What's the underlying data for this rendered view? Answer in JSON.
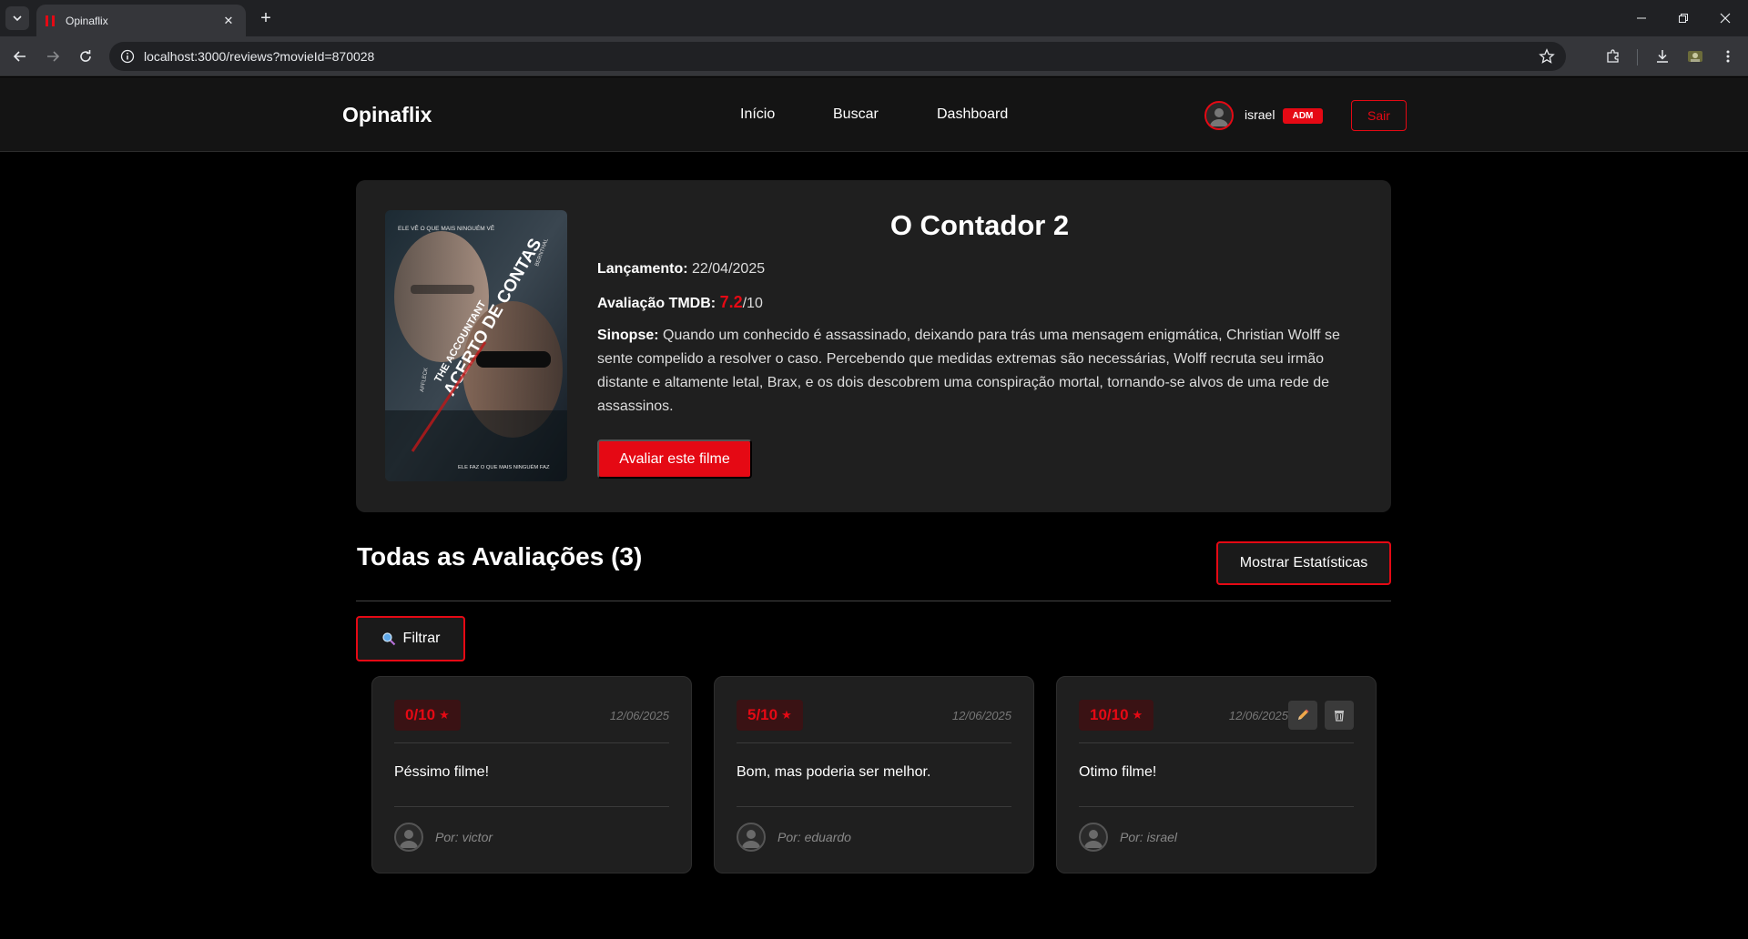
{
  "browser": {
    "tab_title": "Opinaflix",
    "url": "localhost:3000/reviews?movieId=870028"
  },
  "colors": {
    "accent": "#e50914",
    "background": "#000000",
    "card": "#1f1f1f",
    "navbar": "#141414"
  },
  "nav": {
    "brand": "Opinaflix",
    "links": [
      "Início",
      "Buscar",
      "Dashboard"
    ],
    "user": "israel",
    "badge": "ADM",
    "logout": "Sair"
  },
  "movie": {
    "title": "O Contador 2",
    "release_label": "Lançamento:",
    "release_date": "22/04/2025",
    "rating_label": "Avaliação TMDB:",
    "rating": "7.2",
    "rating_max": "/10",
    "synopsis_label": "Sinopse:",
    "synopsis": "Quando um conhecido é assassinado, deixando para trás uma mensagem enigmática, Christian Wolff se sente compelido a resolver o caso. Percebendo que medidas extremas são necessárias, Wolff recruta seu irmão distante e altamente letal, Brax, e os dois descobrem uma conspiração mortal, tornando-se alvos de uma rede de assassinos.",
    "rate_button": "Avaliar este filme",
    "poster": {
      "top_tagline": "ELE VÊ O QUE MAIS NINGUÉM VÊ",
      "title_small": "THE ACCOUNTANT",
      "title_big": "ACERTO DE CONTAS",
      "actor_left": "AFFLECK",
      "actor_right": "BERNTHAL",
      "bottom_tagline": "ELE FAZ O QUE MAIS NINGUÉM FAZ"
    }
  },
  "reviews": {
    "heading": "Todas as Avaliações (3)",
    "stats_button": "Mostrar Estatísticas",
    "filter_button": "Filtrar",
    "items": [
      {
        "score": "0/10",
        "date": "12/06/2025",
        "text": "Péssimo filme!",
        "author": "Por: victor"
      },
      {
        "score": "5/10",
        "date": "12/06/2025",
        "text": "Bom, mas poderia ser melhor.",
        "author": "Por: eduardo"
      },
      {
        "score": "10/10",
        "date": "12/06/2025",
        "text": "Otimo filme!",
        "author": "Por: israel"
      }
    ]
  }
}
